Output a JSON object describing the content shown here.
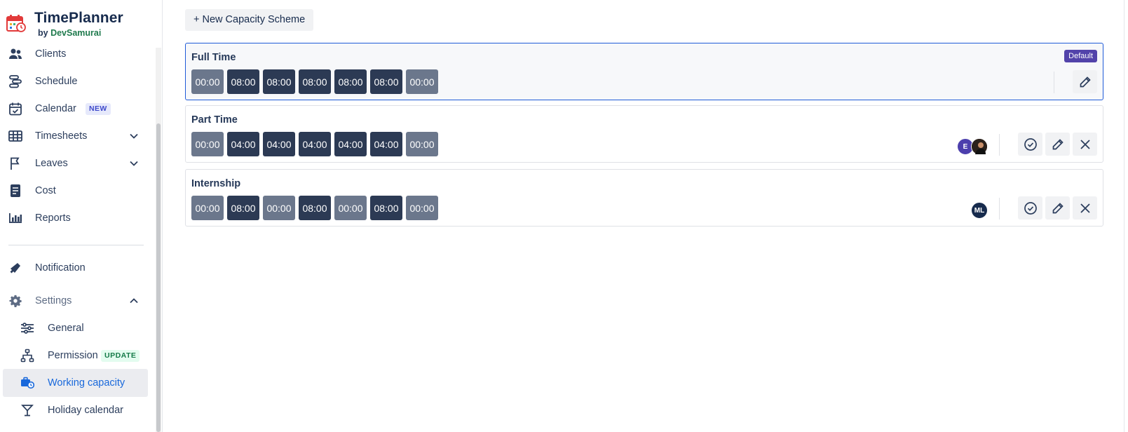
{
  "brand": {
    "name": "TimePlanner",
    "by_prefix": "by",
    "by_name": "DevSamurai"
  },
  "sidebar": {
    "items": [
      {
        "label": "Clients",
        "icon": "users-icon"
      },
      {
        "label": "Schedule",
        "icon": "schedule-icon"
      },
      {
        "label": "Calendar",
        "icon": "calendar-check-icon",
        "badge": "NEW"
      },
      {
        "label": "Timesheets",
        "icon": "table-grid-icon"
      },
      {
        "label": "Leaves",
        "icon": "flag-icon"
      },
      {
        "label": "Cost",
        "icon": "receipt-icon"
      },
      {
        "label": "Reports",
        "icon": "bar-chart-icon"
      }
    ],
    "notification": {
      "label": "Notification",
      "icon": "megaphone-icon"
    },
    "settings": {
      "label": "Settings",
      "icon": "gear-icon",
      "children": [
        {
          "label": "General",
          "icon": "sliders-icon"
        },
        {
          "label": "Permission",
          "icon": "hierarchy-icon",
          "badge": "UPDATE"
        },
        {
          "label": "Working capacity",
          "icon": "briefcase-clock-icon",
          "active": true
        },
        {
          "label": "Holiday calendar",
          "icon": "cocktail-icon"
        }
      ]
    }
  },
  "main": {
    "new_button_label": "+ New Capacity Scheme",
    "schemes": [
      {
        "name": "Full Time",
        "default_badge": "Default",
        "hours": [
          "00:00",
          "08:00",
          "08:00",
          "08:00",
          "08:00",
          "08:00",
          "00:00"
        ],
        "working": [
          false,
          true,
          true,
          true,
          true,
          true,
          false
        ]
      },
      {
        "name": "Part Time",
        "hours": [
          "00:00",
          "04:00",
          "04:00",
          "04:00",
          "04:00",
          "04:00",
          "00:00"
        ],
        "working": [
          false,
          true,
          true,
          true,
          true,
          true,
          false
        ],
        "avatars": [
          {
            "initials": "E",
            "color": "#4c3fad"
          },
          {
            "initials": "",
            "color": "#3a2a22"
          }
        ]
      },
      {
        "name": "Internship",
        "hours": [
          "00:00",
          "08:00",
          "00:00",
          "08:00",
          "00:00",
          "08:00",
          "00:00"
        ],
        "working": [
          false,
          true,
          false,
          true,
          false,
          true,
          false
        ],
        "avatars": [
          {
            "initials": "ML",
            "color": "#172b4d"
          }
        ]
      }
    ]
  },
  "colors": {
    "accent": "#1868db",
    "day_on": "#2c3a54",
    "day_off": "#6b778c",
    "default_badge": "#5243aa",
    "selected_border": "#1f5bd8"
  }
}
